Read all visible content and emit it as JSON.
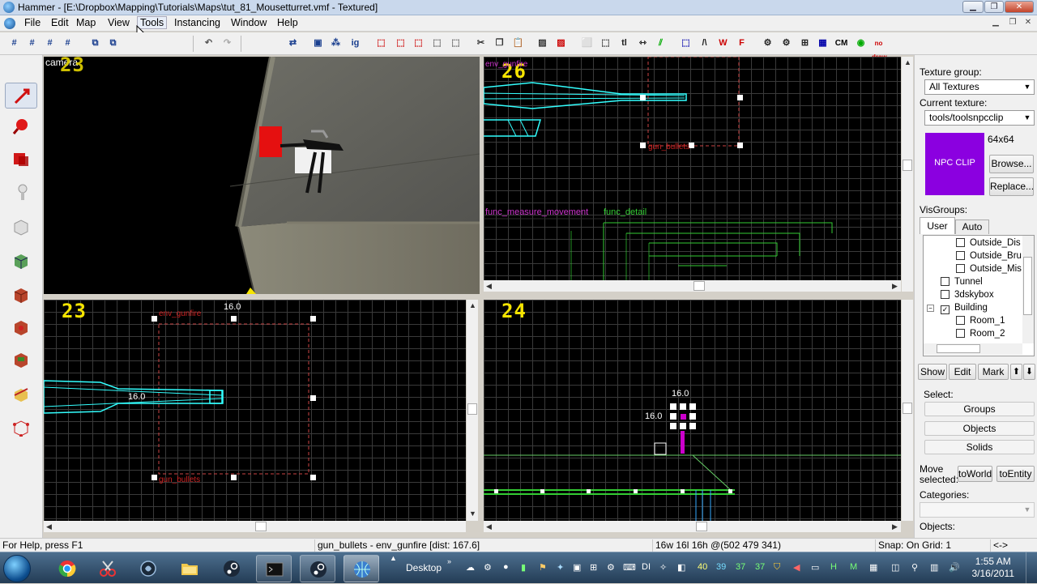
{
  "window": {
    "title": "Hammer - [E:\\Dropbox\\Mapping\\Tutorials\\Maps\\tut_81_Mousetturret.vmf - Textured]"
  },
  "menu": [
    "File",
    "Edit",
    "Map",
    "View",
    "Tools",
    "Instancing",
    "Window",
    "Help"
  ],
  "menu_active": "Tools",
  "viewports": {
    "camera": {
      "label": "camera",
      "number": "23"
    },
    "top_right": {
      "number": "26",
      "labels": [
        "env_gunfire",
        "gun_bullets",
        "func_measure_movement",
        "func_detail"
      ]
    },
    "bottom_left": {
      "number": "23",
      "dim_top": "16.0",
      "dim_left": "16.0",
      "labels": [
        "env_gunfire",
        "gun_bullets"
      ]
    },
    "bottom_right": {
      "number": "24",
      "dim_top": "16.0",
      "dim_left": "16.0"
    }
  },
  "panel": {
    "texture_group_label": "Texture group:",
    "texture_group_value": "All Textures",
    "current_texture_label": "Current texture:",
    "current_texture_value": "tools/toolsnpcclip",
    "texture_preview_text": "NPC CLIP",
    "texture_preview_color": "#8b00e0",
    "texture_size": "64x64",
    "browse": "Browse...",
    "replace": "Replace...",
    "visgroups_label": "VisGroups:",
    "tab_user": "User",
    "tab_auto": "Auto",
    "tree": [
      {
        "label": "Outside_Dis",
        "indent": 2,
        "checked": false
      },
      {
        "label": "Outside_Bru",
        "indent": 2,
        "checked": false
      },
      {
        "label": "Outside_Mis",
        "indent": 2,
        "checked": false
      },
      {
        "label": "Tunnel",
        "indent": 1,
        "checked": false
      },
      {
        "label": "3dskybox",
        "indent": 1,
        "checked": false
      },
      {
        "label": "Building",
        "indent": 1,
        "checked": true
      },
      {
        "label": "Room_1",
        "indent": 2,
        "checked": false
      },
      {
        "label": "Room_2",
        "indent": 2,
        "checked": false
      }
    ],
    "show": "Show",
    "edit": "Edit",
    "mark": "Mark",
    "up_arrow": "⬆",
    "down_arrow": "⬇",
    "select_label": "Select:",
    "groups": "Groups",
    "objects_btn": "Objects",
    "solids": "Solids",
    "move_selected": "Move selected:",
    "to_world": "toWorld",
    "to_entity": "toEntity",
    "categories_label": "Categories:",
    "objects_label": "Objects:"
  },
  "status": {
    "help": "For Help, press F1",
    "selection": "gun_bullets - env_gunfire  [dist: 167.6]",
    "size": "16w 16l 16h @(502 479 341)",
    "snap": "Snap: On Grid: 1",
    "nav": "<->"
  },
  "taskbar": {
    "desktop": "Desktop",
    "tray_numbers": [
      "40",
      "39",
      "37",
      "37"
    ],
    "time": "1:55 AM",
    "date": "3/16/2011"
  }
}
